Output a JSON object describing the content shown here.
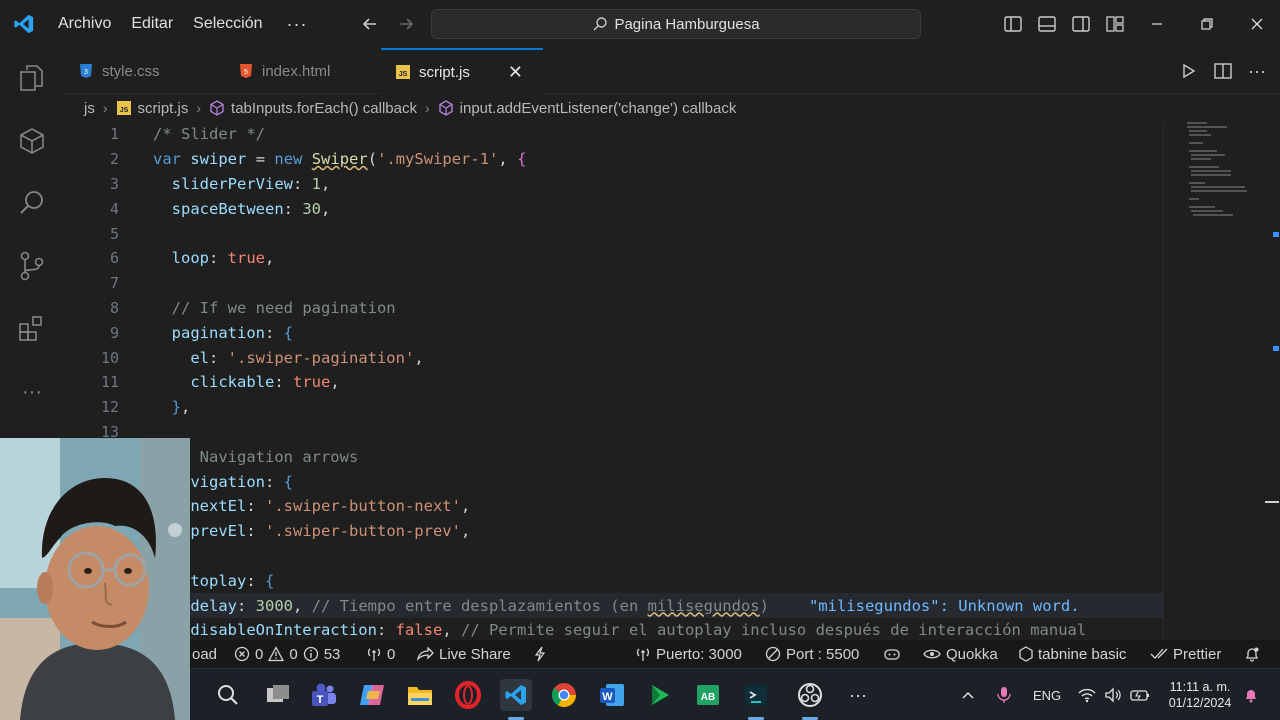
{
  "titlebar": {
    "menu": [
      "Archivo",
      "Editar",
      "Selección"
    ],
    "more": "···",
    "search_text": "Pagina Hamburguesa"
  },
  "tabs": [
    {
      "label": "style.css",
      "icon": "css-file-icon",
      "active": false
    },
    {
      "label": "index.html",
      "icon": "html-file-icon",
      "active": false
    },
    {
      "label": "script.js",
      "icon": "js-file-icon",
      "active": true
    }
  ],
  "breadcrumb": {
    "folder": "js",
    "file": "script.js",
    "symbol1": "tabInputs.forEach() callback",
    "symbol2": "input.addEventListener('change') callback"
  },
  "editor": {
    "line_numbers": [
      "1",
      "2",
      "3",
      "4",
      "5",
      "6",
      "7",
      "8",
      "9",
      "10",
      "11",
      "12",
      "13"
    ],
    "hint": "\"milisegundos\": Unknown word."
  },
  "statusbar": {
    "left_fragment": "oad",
    "errors": "0",
    "warnings": "0",
    "info": "53",
    "ports_count": "0",
    "live_share": "Live Share",
    "puerto": "Puerto: 3000",
    "port": "Port : 5500",
    "quokka": "Quokka",
    "tabnine": "tabnine basic",
    "prettier": "Prettier"
  },
  "taskbar": {
    "lang": "ENG",
    "time": "11:11 a. m.",
    "date": "01/12/2024"
  },
  "colors": {
    "accent": "#0078d4",
    "keyword": "#569cd6",
    "string": "#ce9178"
  }
}
